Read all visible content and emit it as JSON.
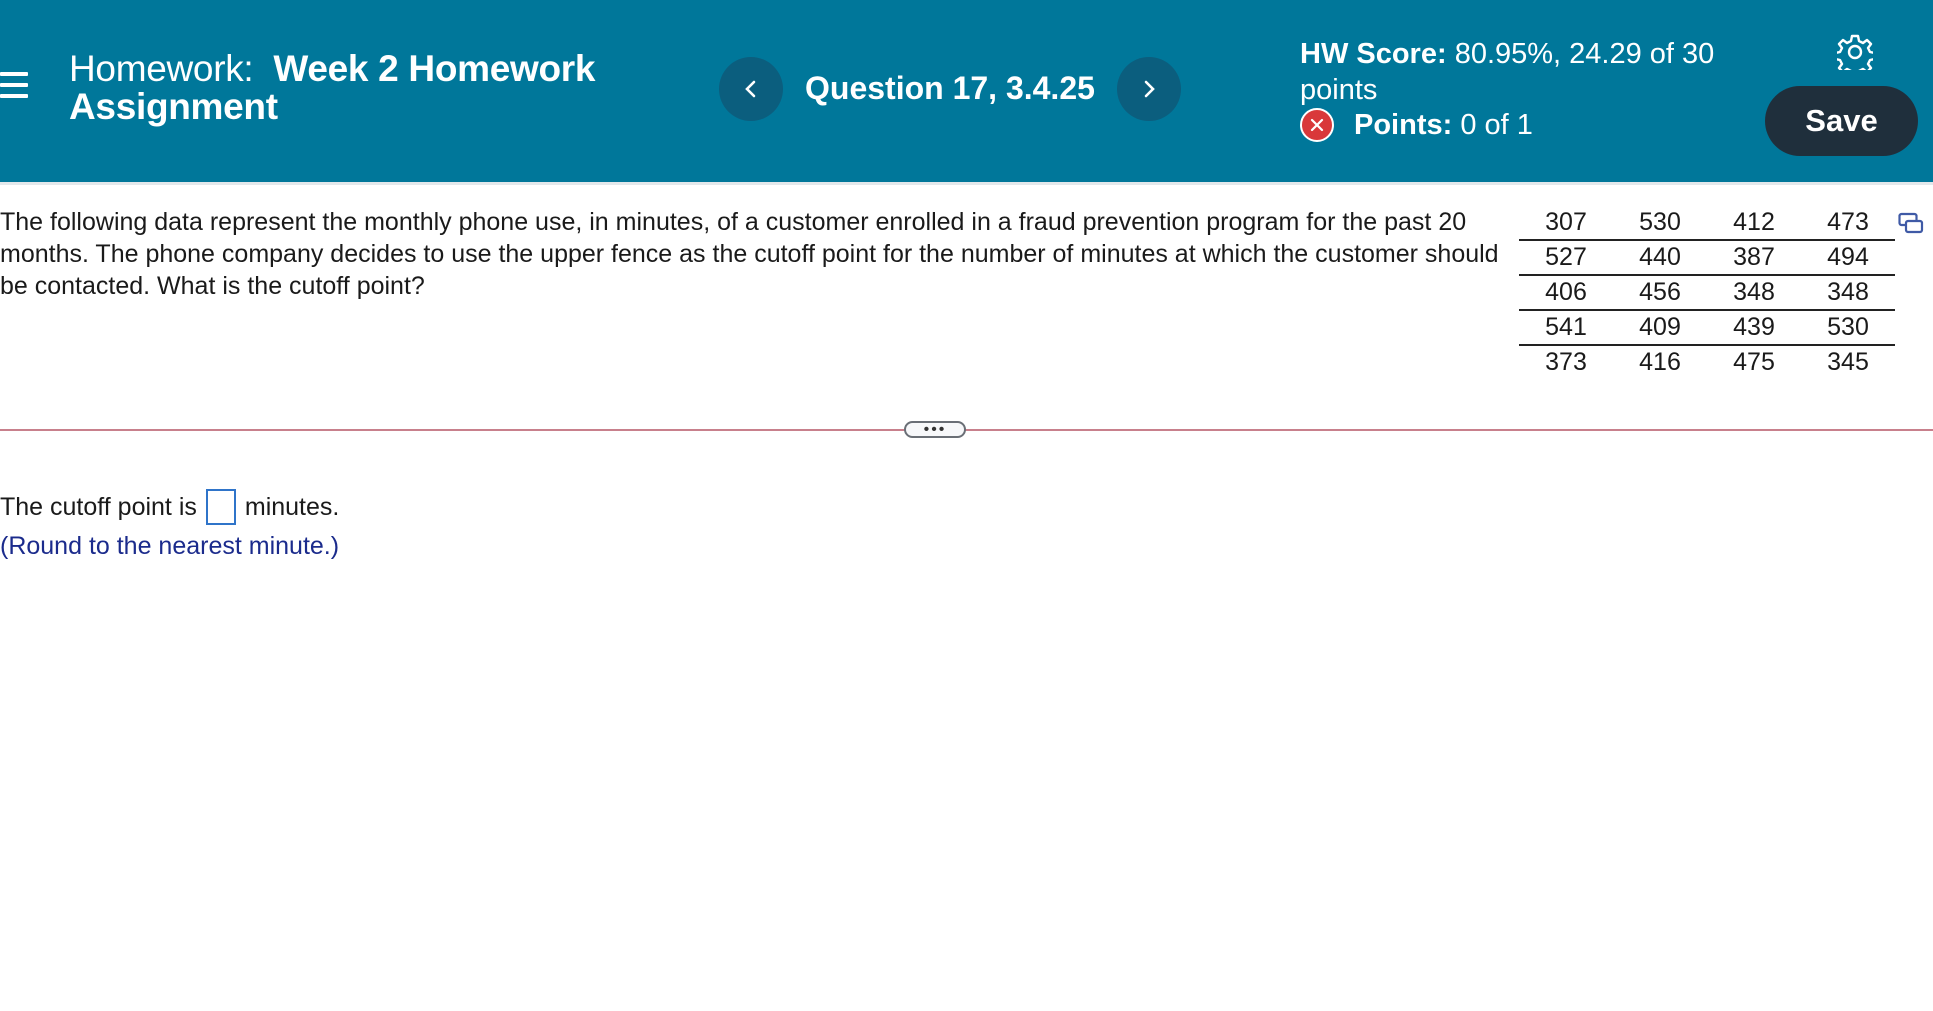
{
  "header": {
    "title_prefix": "Homework:",
    "title_name": "Week 2 Homework",
    "title_name_line2": "Assignment",
    "question_label": "Question 17, 3.4.25",
    "hw_score_label": "HW Score:",
    "hw_score_value": "80.95%, 24.29 of 30",
    "hw_score_value_line2": "points",
    "points_label": "Points:",
    "points_value": "0 of 1",
    "save_label": "Save",
    "colors": {
      "header_bg": "#00779a",
      "nav_btn": "#0b5e7e",
      "save_bg": "#1f2f3c",
      "x_badge": "#d9383a"
    }
  },
  "icons": {
    "menu": "hamburger-menu-icon",
    "prev": "chevron-left-icon",
    "next": "chevron-right-icon",
    "incorrect": "x-circle-icon",
    "settings": "gear-icon",
    "copy": "copy-data-icon"
  },
  "question": {
    "text": "The following data represent the monthly phone use, in minutes, of a customer enrolled in a fraud prevention program for the past 20 months. The phone company decides to use the upper fence as the cutoff point for the number of minutes at which the customer should be contacted. What is the cutoff point?",
    "data_rows": [
      [
        "307",
        "530",
        "412",
        "473"
      ],
      [
        "527",
        "440",
        "387",
        "494"
      ],
      [
        "406",
        "456",
        "348",
        "348"
      ],
      [
        "541",
        "409",
        "439",
        "530"
      ],
      [
        "373",
        "416",
        "475",
        "345"
      ]
    ]
  },
  "more_label": "•••",
  "answer": {
    "prefix": "The cutoff point is",
    "suffix": "minutes.",
    "value": "",
    "hint": "(Round to the nearest minute.)"
  }
}
